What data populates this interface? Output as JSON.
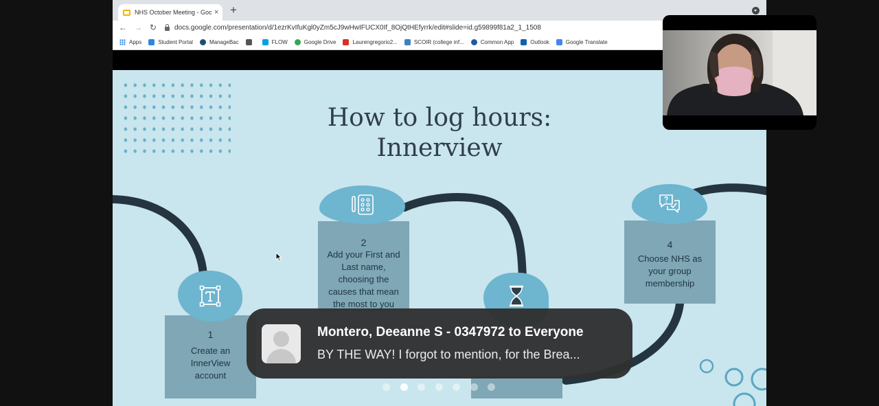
{
  "browser": {
    "tab_title": "NHS October Meeting - Google Slides",
    "new_tab_glyph": "+",
    "close_glyph": "×",
    "url": "docs.google.com/presentation/d/1ezrKvIfuKgl0yZm5cJ9wHwIFUCX0If_8OjQtHEfyrrk/edit#slide=id.g59899f81a2_1_1508",
    "nav": {
      "back": "←",
      "forward": "→",
      "reload": "↻"
    },
    "bookmarks": [
      {
        "label": "Apps",
        "icon": "apps-grid-icon",
        "color": "#1a73e8"
      },
      {
        "label": "Student Portal",
        "icon": "student-portal-icon",
        "color": "#2e86de"
      },
      {
        "label": "ManageBac",
        "icon": "managebac-icon",
        "color": "#1b4f72"
      },
      {
        "label": "",
        "icon": "bookmark-icon",
        "color": "#555555"
      },
      {
        "label": "FLOW",
        "icon": "flow-icon",
        "color": "#00a3e0"
      },
      {
        "label": "Google Drive",
        "icon": "google-drive-icon",
        "color": "#34a853"
      },
      {
        "label": "Laurengregorio2...",
        "icon": "gmail-icon",
        "color": "#d93025"
      },
      {
        "label": "SCOIR (college inf...",
        "icon": "scoir-icon",
        "color": "#3b82c4"
      },
      {
        "label": "Common App",
        "icon": "common-app-icon",
        "color": "#1e5aa8"
      },
      {
        "label": "Outlook",
        "icon": "outlook-icon",
        "color": "#0a64ad"
      },
      {
        "label": "Google Translate",
        "icon": "google-translate-icon",
        "color": "#4285f4"
      }
    ]
  },
  "slide": {
    "title_line1": "How to log hours:",
    "title_line2": "Innerview",
    "steps": [
      {
        "number": "1",
        "text": "Create an InnerView account",
        "icon": "text-tool-icon"
      },
      {
        "number": "2",
        "text": "Add your First and Last name, choosing the causes that mean the most to you",
        "icon": "keypad-icon"
      },
      {
        "number": "",
        "text": "",
        "icon": "hourglass-icon"
      },
      {
        "number": "4",
        "text": "Choose NHS as your group membership",
        "icon": "chat-question-icon"
      }
    ],
    "page_count": 7,
    "active_page": 2
  },
  "notification": {
    "title": "Montero, Deeanne S - 0347972 to Everyone",
    "message": "BY THE WAY! I forgot to mention, for the Brea..."
  },
  "colors": {
    "slide_bg": "#c9e5ee",
    "box": "#7fa7b6",
    "blob": "#6eb5cf",
    "curve": "#243540",
    "title": "#2f3f4a"
  }
}
